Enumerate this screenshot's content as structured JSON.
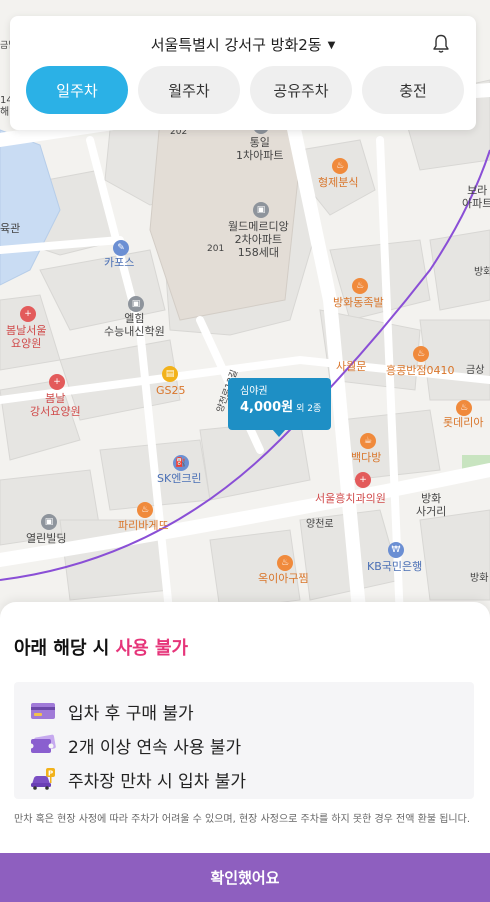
{
  "header": {
    "location": "서울특별시 강서구 방화2동",
    "tabs": [
      {
        "label": "일주차",
        "active": true
      },
      {
        "label": "월주차",
        "active": false
      },
      {
        "label": "공유주차",
        "active": false
      },
      {
        "label": "충전",
        "active": false
      }
    ]
  },
  "map": {
    "labels": {
      "tongil": "통일\n1차아파트",
      "hyungje": "형제분식",
      "world": "월드메르디앙\n2차아파트\n158세대",
      "kapos": "카포스",
      "elhim": "엘힘\n수능내신학원",
      "bangwha_jok": "방화동족발",
      "bomnal1": "봄날서울\n요양원",
      "gs25": "GS25",
      "saweol": "사월문",
      "heunghong": "흥콩반점0410",
      "bomnal2": "봄날\n강서요양원",
      "lotteria": "롯데리아",
      "baekda": "백다방",
      "sk": "SK엔크린",
      "dental": "서울흥치과의원",
      "paris": "파리바게뜨",
      "yeolin": "열린빌딩",
      "bangwha_cross": "방화\n사거리",
      "okiya": "옥이아구찜",
      "kb": "KB국민은행",
      "yangcheon": "양천로",
      "road133": "양천로13길",
      "num202": "202",
      "num201": "201",
      "edge_bo": "보라\n아파트",
      "edge_gwan": "육관",
      "edge_geum": "금남",
      "edge_bang": "방화",
      "edge_bang2": "방화",
      "edge_geum2": "금상",
      "edge_14": "14",
      "edge_hae": "해"
    },
    "parking": {
      "name": "심야권",
      "price": "4,000원",
      "extra": "외 2종"
    }
  },
  "sheet": {
    "title_prefix": "아래 해당 시 ",
    "title_accent": "사용 불가",
    "items": [
      {
        "text": "입차 후 구매 불가",
        "icon": "card-icon"
      },
      {
        "text": "2개 이상 연속 사용 불가",
        "icon": "ticket-icon"
      },
      {
        "text": "주차장 만차 시 입차 불가",
        "icon": "car-parking-icon"
      }
    ],
    "fine_print": "만차 혹은 현장 사정에 따라 주차가 어려울 수 있으며, 현장 사정으로 주차를 하지 못한 경우 전액 환불 됩니다.",
    "confirm_label": "확인했어요"
  },
  "colors": {
    "tab_active": "#2bb1e6",
    "accent": "#e6357a",
    "confirm": "#8e5fbf",
    "marker": "#1e8fc5"
  }
}
